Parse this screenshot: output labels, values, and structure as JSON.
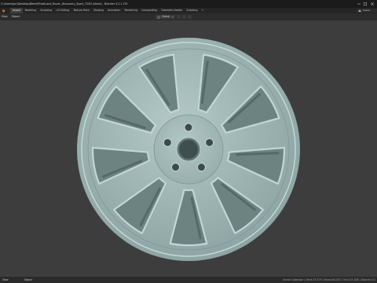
{
  "window": {
    "title": "C:\\Users\\jan\\Desktop\\Blend\\Prod\\Land_Rover_Discovery_Sport_7230\\.blend] - Blender 4.2.1 LTS"
  },
  "workspace_tabs": [
    {
      "label": "Layout",
      "active": true
    },
    {
      "label": "Modeling",
      "active": false
    },
    {
      "label": "Sculpting",
      "active": false
    },
    {
      "label": "UV Editing",
      "active": false
    },
    {
      "label": "Texture Paint",
      "active": false
    },
    {
      "label": "Shading",
      "active": false
    },
    {
      "label": "Animation",
      "active": false
    },
    {
      "label": "Rendering",
      "active": false
    },
    {
      "label": "Compositing",
      "active": false
    },
    {
      "label": "Geometry Nodes",
      "active": false
    },
    {
      "label": "Scripting",
      "active": false
    }
  ],
  "add_tab_label": "+",
  "scene": {
    "label": "Scene"
  },
  "header": {
    "menu": [
      "View",
      "Object"
    ],
    "transform_orientation": "Global"
  },
  "statusbar": {
    "left": [
      "View",
      "Object"
    ],
    "right": "Scene Collection | Verts:75,574 | Faces:64,432 | Tris:127,408 | Objects:1/1"
  },
  "colors": {
    "wheel_fill": "#9fb6b5",
    "wheel_rim": "#bcd0cf",
    "wheel_shadow": "#6f8685",
    "viewport_bg": "#3d3d3d"
  },
  "icons": {
    "blender_logo": "blender-logo-icon",
    "pivot": "pivot-point-icon",
    "snap": "magnet-icon",
    "proportional": "proportional-editing-icon"
  }
}
